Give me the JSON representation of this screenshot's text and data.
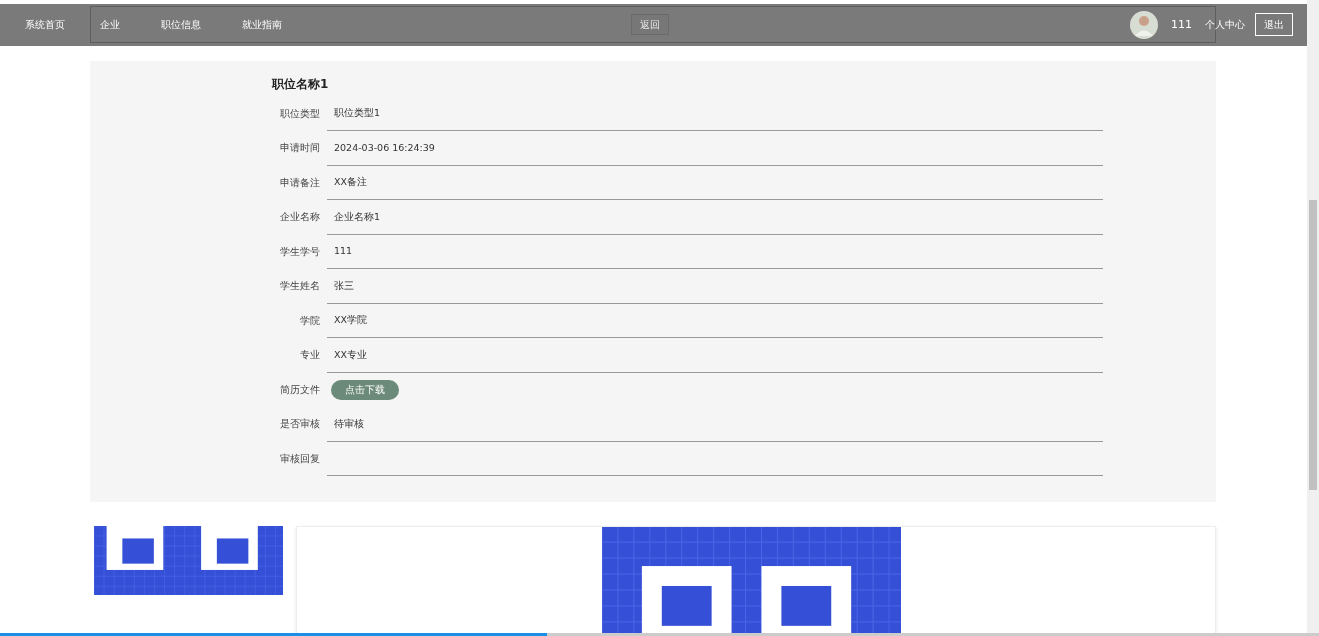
{
  "nav": {
    "home": "系统首页",
    "items": [
      {
        "label": "企业"
      },
      {
        "label": "职位信息"
      },
      {
        "label": "就业指南"
      }
    ],
    "back": "返回",
    "user": "111",
    "profile": "个人中心",
    "logout": "退出"
  },
  "detail": {
    "title": "职位名称1",
    "fields": [
      {
        "kind": "text",
        "label": "职位类型",
        "value": "职位类型1"
      },
      {
        "kind": "text",
        "label": "申请时间",
        "value": "2024-03-06 16:24:39"
      },
      {
        "kind": "text",
        "label": "申请备注",
        "value": "XX备注"
      },
      {
        "kind": "text",
        "label": "企业名称",
        "value": "企业名称1"
      },
      {
        "kind": "text",
        "label": "学生学号",
        "value": "111"
      },
      {
        "kind": "text",
        "label": "学生姓名",
        "value": "张三"
      },
      {
        "kind": "text",
        "label": "学院",
        "value": "XX学院"
      },
      {
        "kind": "text",
        "label": "专业",
        "value": "XX专业"
      },
      {
        "kind": "button",
        "label": "简历文件",
        "value": "点击下载"
      },
      {
        "kind": "text",
        "label": "是否审核",
        "value": "待审核"
      },
      {
        "kind": "text",
        "label": "审核回复"
      }
    ]
  },
  "playback": {
    "level": 0.415
  }
}
